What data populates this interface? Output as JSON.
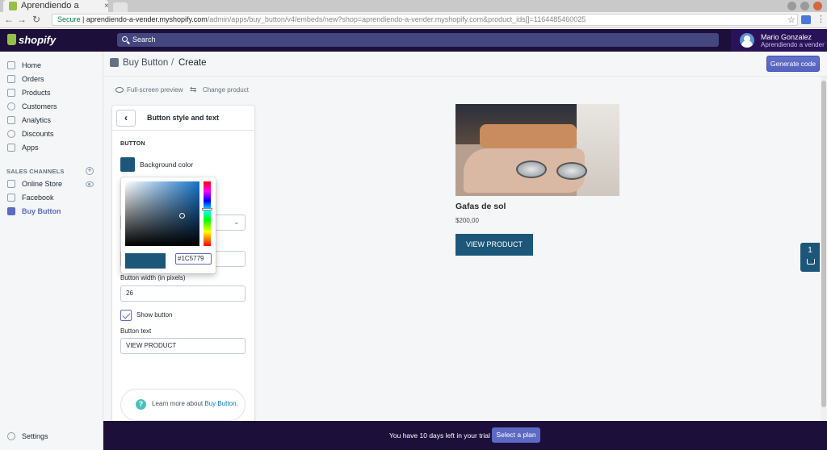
{
  "browser": {
    "tab_title": "Aprendiendo a",
    "tab_close": "×",
    "secure_label": "Secure",
    "url_host": "aprendiendo-a-vender.myshopify.com",
    "url_path": "/admin/apps/buy_button/v4/embeds/new?shop=aprendiendo-a-vender.myshopify.com&product_ids[]=1164485460025",
    "nav_back": "←",
    "nav_forward": "→",
    "nav_reload": "↻",
    "star": "☆",
    "kebab": "⋮"
  },
  "topbar": {
    "logo": "shopify",
    "search_placeholder": "Search",
    "user_name": "Mario Gonzalez",
    "user_store": "Aprendiendo a vender"
  },
  "sidebar": {
    "items": [
      {
        "label": "Home",
        "icon": "home-icon"
      },
      {
        "label": "Orders",
        "icon": "orders-icon"
      },
      {
        "label": "Products",
        "icon": "tag-icon"
      },
      {
        "label": "Customers",
        "icon": "customers-icon"
      },
      {
        "label": "Analytics",
        "icon": "analytics-icon"
      },
      {
        "label": "Discounts",
        "icon": "discount-icon"
      },
      {
        "label": "Apps",
        "icon": "apps-icon"
      }
    ],
    "channels_title": "SALES CHANNELS",
    "channels_add": "+",
    "channels": [
      {
        "label": "Online Store",
        "icon": "store-icon"
      },
      {
        "label": "Facebook",
        "icon": "facebook-icon"
      },
      {
        "label": "Buy Button",
        "icon": "buy-button-icon",
        "active": true
      }
    ],
    "settings_label": "Settings"
  },
  "header": {
    "breadcrumb": "Buy Button",
    "separator": "/",
    "title": "Create",
    "generate_label": "Generate code"
  },
  "toolbar": {
    "preview_label": "Full-screen preview",
    "change_label": "Change product",
    "swap_glyph": "⇆"
  },
  "panel": {
    "back_glyph": "‹",
    "title": "Button style and text",
    "section": "BUTTON",
    "background_label": "Background color",
    "select_chevron": "⌄",
    "width_label": "Button width (in pixels)",
    "width_value": "26",
    "show_label": "Show button",
    "text_label": "Button text",
    "text_value": "VIEW PRODUCT",
    "help_prefix": "Learn more about ",
    "help_link": "Buy Button",
    "help_suffix": ".",
    "help_glyph": "?"
  },
  "picker": {
    "hex_value": "#1C5779"
  },
  "product": {
    "title": "Gafas de sol",
    "price": "$200,00",
    "button_label": "VIEW PRODUCT",
    "cart_count": "1"
  },
  "trial": {
    "text": "You have 10 days left in your trial",
    "plan_label": "Select a plan"
  },
  "colors": {
    "accent": "#5c6ac4",
    "topbar": "#1c0f3a",
    "button_bg": "#1c5779"
  }
}
